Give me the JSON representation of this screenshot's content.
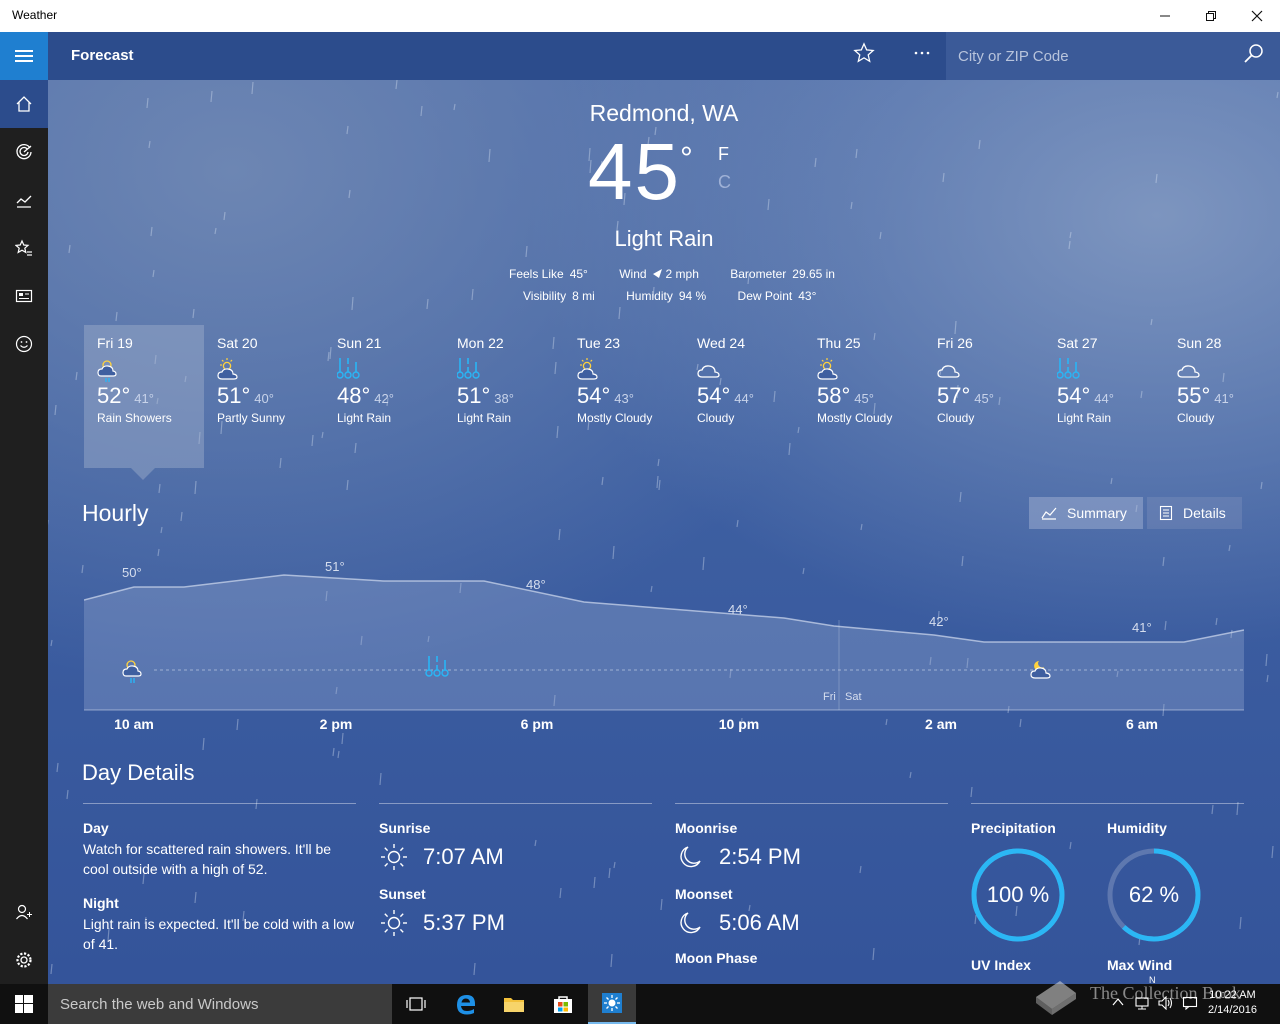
{
  "window": {
    "title": "Weather"
  },
  "header": {
    "title": "Forecast",
    "search_placeholder": "City or ZIP Code"
  },
  "current": {
    "city": "Redmond, WA",
    "temp": "45",
    "degree": "°",
    "unit_f": "F",
    "unit_c": "C",
    "condition": "Light Rain",
    "stats_row1": [
      {
        "label": "Feels Like",
        "value": "45°"
      },
      {
        "label": "Wind",
        "value": "2 mph"
      },
      {
        "label": "Barometer",
        "value": "29.65 in"
      }
    ],
    "stats_row2": [
      {
        "label": "Visibility",
        "value": "8 mi"
      },
      {
        "label": "Humidity",
        "value": "94 %"
      },
      {
        "label": "Dew Point",
        "value": "43°"
      }
    ]
  },
  "daily": [
    {
      "day": "Fri 19",
      "hi": "52°",
      "lo": "41°",
      "cond": "Rain Showers",
      "icon": "rain-showers-icon"
    },
    {
      "day": "Sat 20",
      "hi": "51°",
      "lo": "40°",
      "cond": "Partly Sunny",
      "icon": "partly-sunny-icon"
    },
    {
      "day": "Sun 21",
      "hi": "48°",
      "lo": "42°",
      "cond": "Light Rain",
      "icon": "light-rain-icon"
    },
    {
      "day": "Mon 22",
      "hi": "51°",
      "lo": "38°",
      "cond": "Light Rain",
      "icon": "light-rain-icon"
    },
    {
      "day": "Tue 23",
      "hi": "54°",
      "lo": "43°",
      "cond": "Mostly Cloudy",
      "icon": "partly-sunny-icon"
    },
    {
      "day": "Wed 24",
      "hi": "54°",
      "lo": "44°",
      "cond": "Cloudy",
      "icon": "cloud-icon"
    },
    {
      "day": "Thu 25",
      "hi": "58°",
      "lo": "45°",
      "cond": "Mostly Cloudy",
      "icon": "partly-sunny-icon"
    },
    {
      "day": "Fri 26",
      "hi": "57°",
      "lo": "45°",
      "cond": "Cloudy",
      "icon": "cloud-icon"
    },
    {
      "day": "Sat 27",
      "hi": "54°",
      "lo": "44°",
      "cond": "Light Rain",
      "icon": "light-rain-icon"
    },
    {
      "day": "Sun 28",
      "hi": "55°",
      "lo": "41°",
      "cond": "Cloudy",
      "icon": "cloud-icon"
    }
  ],
  "hourly": {
    "title": "Hourly",
    "summary_label": "Summary",
    "details_label": "Details",
    "temp_labels": [
      "50°",
      "51°",
      "48°",
      "44°",
      "42°",
      "41°"
    ],
    "hour_labels": [
      "10 am",
      "2 pm",
      "6 pm",
      "10 pm",
      "2 am",
      "6 am"
    ],
    "day_divider_left": "Fri",
    "day_divider_right": "Sat"
  },
  "day_details": {
    "title": "Day Details",
    "day_heading": "Day",
    "day_text": "Watch for scattered rain showers. It'll be cool outside with a high of 52.",
    "night_heading": "Night",
    "night_text": "Light rain is expected. It'll be cold with a low of 41.",
    "sunrise_label": "Sunrise",
    "sunrise": "7:07 AM",
    "sunset_label": "Sunset",
    "sunset": "5:37 PM",
    "moonrise_label": "Moonrise",
    "moonrise": "2:54 PM",
    "moonset_label": "Moonset",
    "moonset": "5:06 AM",
    "moonphase_label": "Moon Phase",
    "precip_label": "Precipitation",
    "precip_value": "100 %",
    "precip_fraction": 1.0,
    "humidity_label": "Humidity",
    "humidity_value": "62 %",
    "humidity_fraction": 0.62,
    "uv_label": "UV Index",
    "wind_label": "Max Wind",
    "wind_dir": "N"
  },
  "taskbar": {
    "search_placeholder": "Search the web and Windows",
    "time": "10:22 AM",
    "date": "2/14/2016"
  },
  "watermark": "The Collection Book",
  "colors": {
    "accent": "#1f7fd0",
    "ring": "#2bb7f5",
    "header": "#2c4c8c"
  }
}
